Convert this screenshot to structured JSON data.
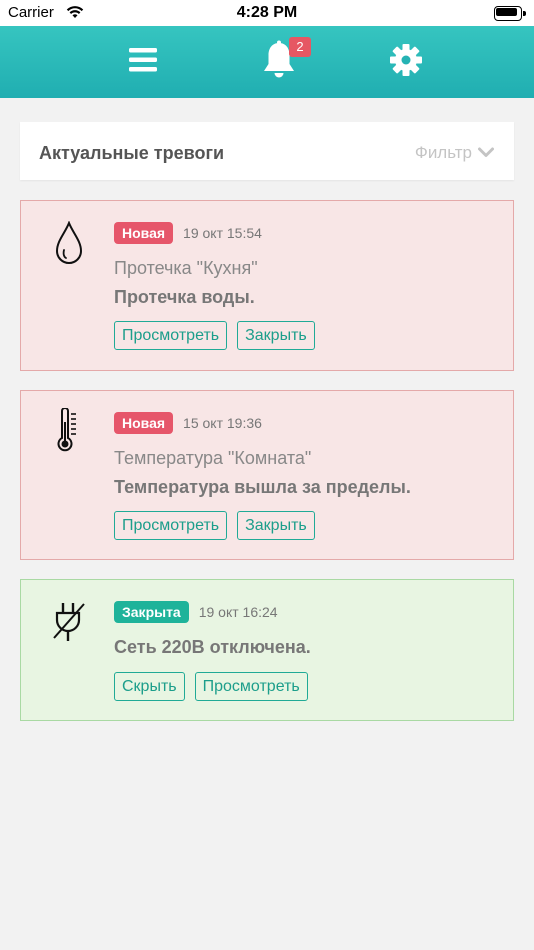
{
  "status_bar": {
    "carrier": "Carrier",
    "time": "4:28 PM"
  },
  "topnav": {
    "menu_icon": "hamburger-menu-icon",
    "bell_icon": "bell-icon",
    "settings_icon": "gear-icon",
    "notification_count": "2",
    "colors": {
      "gradient_top": "#36c5c0",
      "gradient_bottom": "#20aeb1",
      "badge": "#e65763"
    }
  },
  "header": {
    "title": "Актуальные тревоги",
    "filter_label": "Фильтр"
  },
  "alarms": [
    {
      "state": "new",
      "icon": "water-drop-icon",
      "status": "Новая",
      "time": "19 окт 15:54",
      "title": "Протечка \"Кухня\"",
      "description": "Протечка воды.",
      "actions": [
        "Просмотреть",
        "Закрыть"
      ]
    },
    {
      "state": "new",
      "icon": "thermometer-icon",
      "status": "Новая",
      "time": "15 окт 19:36",
      "title": "Температура \"Комната\"",
      "description": "Температура вышла за пределы.",
      "actions": [
        "Просмотреть",
        "Закрыть"
      ]
    },
    {
      "state": "closed",
      "icon": "power-plug-off-icon",
      "status": "Закрыта",
      "time": "19 окт 16:24",
      "title": "",
      "description": "Сеть 220В отключена.",
      "actions": [
        "Скрыть",
        "Просмотреть"
      ]
    }
  ],
  "colors": {
    "new_badge": "#e6566a",
    "closed_badge": "#1eb39a",
    "accent": "#20aa96",
    "card_red_bg": "#f8e6e6",
    "card_green_bg": "#e8f5e2"
  }
}
